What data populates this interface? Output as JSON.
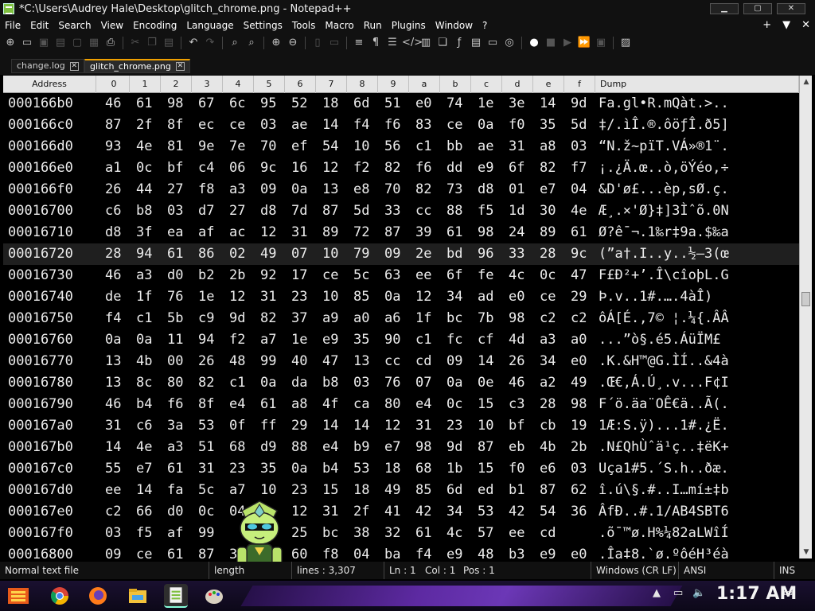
{
  "window": {
    "title": "*C:\\Users\\Audrey Hale\\Desktop\\glitch_chrome.png - Notepad++",
    "minimize_glyph": "▁",
    "restore_glyph": "▢",
    "close_glyph": "✕"
  },
  "menu": {
    "items": [
      "File",
      "Edit",
      "Search",
      "View",
      "Encoding",
      "Language",
      "Settings",
      "Tools",
      "Macro",
      "Run",
      "Plugins",
      "Window",
      "?"
    ],
    "right": [
      "+",
      "▼",
      "✕"
    ]
  },
  "tabs": [
    {
      "label": "change.log",
      "close": "✕"
    },
    {
      "label": "glitch_chrome.png",
      "close": "✕"
    }
  ],
  "hex": {
    "address_header": "Address",
    "column_headers": [
      "0",
      "1",
      "2",
      "3",
      "4",
      "5",
      "6",
      "7",
      "8",
      "9",
      "a",
      "b",
      "c",
      "d",
      "e",
      "f"
    ],
    "dump_header": "Dump",
    "rows": [
      {
        "addr": "000166b0",
        "bytes": [
          "46",
          "61",
          "98",
          "67",
          "6c",
          "95",
          "52",
          "18",
          "6d",
          "51",
          "e0",
          "74",
          "1e",
          "3e",
          "14",
          "9d"
        ],
        "dump": "Fa.gl•R.mQàt.>.."
      },
      {
        "addr": "000166c0",
        "bytes": [
          "87",
          "2f",
          "8f",
          "ec",
          "ce",
          "03",
          "ae",
          "14",
          "f4",
          "f6",
          "83",
          "ce",
          "0a",
          "f0",
          "35",
          "5d"
        ],
        "dump": "‡/.ìÎ.®.ôöƒÎ.ð5]"
      },
      {
        "addr": "000166d0",
        "bytes": [
          "93",
          "4e",
          "81",
          "9e",
          "7e",
          "70",
          "ef",
          "54",
          "10",
          "56",
          "c1",
          "bb",
          "ae",
          "31",
          "a8",
          "03"
        ],
        "dump": "“N.ž~pïT.VÁ»®1¨."
      },
      {
        "addr": "000166e0",
        "bytes": [
          "a1",
          "0c",
          "bf",
          "c4",
          "06",
          "9c",
          "16",
          "12",
          "f2",
          "82",
          "f6",
          "dd",
          "e9",
          "6f",
          "82",
          "f7"
        ],
        "dump": "¡.¿Ä.œ..ò‚öÝéo‚÷"
      },
      {
        "addr": "000166f0",
        "bytes": [
          "26",
          "44",
          "27",
          "f8",
          "a3",
          "09",
          "0a",
          "13",
          "e8",
          "70",
          "82",
          "73",
          "d8",
          "01",
          "e7",
          "04"
        ],
        "dump": "&D'ø£...èp‚sØ.ç."
      },
      {
        "addr": "00016700",
        "bytes": [
          "c6",
          "b8",
          "03",
          "d7",
          "27",
          "d8",
          "7d",
          "87",
          "5d",
          "33",
          "cc",
          "88",
          "f5",
          "1d",
          "30",
          "4e"
        ],
        "dump": "Æ¸.×'Ø}‡]3Ìˆõ.0N"
      },
      {
        "addr": "00016710",
        "bytes": [
          "d8",
          "3f",
          "ea",
          "af",
          "ac",
          "12",
          "31",
          "89",
          "72",
          "87",
          "39",
          "61",
          "98",
          "24",
          "89",
          "61"
        ],
        "dump": "Ø?ê¯¬.1‰r‡9a.$‰a"
      },
      {
        "addr": "00016720",
        "bytes": [
          "28",
          "94",
          "61",
          "86",
          "02",
          "49",
          "07",
          "10",
          "79",
          "09",
          "2e",
          "bd",
          "96",
          "33",
          "28",
          "9c"
        ],
        "dump": "(”a†.I..y..½–3(œ"
      },
      {
        "addr": "00016730",
        "bytes": [
          "46",
          "a3",
          "d0",
          "b2",
          "2b",
          "92",
          "17",
          "ce",
          "5c",
          "63",
          "ee",
          "6f",
          "fe",
          "4c",
          "0c",
          "47"
        ],
        "dump": "F£Ð²+’.Î\\cîoþL.G"
      },
      {
        "addr": "00016740",
        "bytes": [
          "de",
          "1f",
          "76",
          "1e",
          "12",
          "31",
          "23",
          "10",
          "85",
          "0a",
          "12",
          "34",
          "ad",
          "e0",
          "ce",
          "29"
        ],
        "dump": "Þ.v..1#.….4­àÎ)"
      },
      {
        "addr": "00016750",
        "bytes": [
          "f4",
          "c1",
          "5b",
          "c9",
          "9d",
          "82",
          "37",
          "a9",
          "a0",
          "a6",
          "1f",
          "bc",
          "7b",
          "98",
          "c2",
          "c2"
        ],
        "dump": "ôÁ[É.‚7© ¦.¼{.ÂÂ"
      },
      {
        "addr": "00016760",
        "bytes": [
          "0a",
          "0a",
          "11",
          "94",
          "f2",
          "a7",
          "1e",
          "e9",
          "35",
          "90",
          "c1",
          "fc",
          "cf",
          "4d",
          "a3",
          "a0"
        ],
        "dump": "...”ò§.é5.ÁüÏM£ "
      },
      {
        "addr": "00016770",
        "bytes": [
          "13",
          "4b",
          "00",
          "26",
          "48",
          "99",
          "40",
          "47",
          "13",
          "cc",
          "cd",
          "09",
          "14",
          "26",
          "34",
          "e0"
        ],
        "dump": ".K.&H™@G.ÌÍ..&4à"
      },
      {
        "addr": "00016780",
        "bytes": [
          "13",
          "8c",
          "80",
          "82",
          "c1",
          "0a",
          "da",
          "b8",
          "03",
          "76",
          "07",
          "0a",
          "0e",
          "46",
          "a2",
          "49"
        ],
        "dump": ".Œ€‚Á.Ú¸.v...F¢I"
      },
      {
        "addr": "00016790",
        "bytes": [
          "46",
          "b4",
          "f6",
          "8f",
          "e4",
          "61",
          "a8",
          "4f",
          "ca",
          "80",
          "e4",
          "0c",
          "15",
          "c3",
          "28",
          "98"
        ],
        "dump": "F´ö.äa¨OÊ€ä..Ã(."
      },
      {
        "addr": "000167a0",
        "bytes": [
          "31",
          "c6",
          "3a",
          "53",
          "0f",
          "ff",
          "29",
          "14",
          "14",
          "12",
          "31",
          "23",
          "10",
          "bf",
          "cb",
          "19"
        ],
        "dump": "1Æ:S.ÿ)...1#.¿Ë."
      },
      {
        "addr": "000167b0",
        "bytes": [
          "14",
          "4e",
          "a3",
          "51",
          "68",
          "d9",
          "88",
          "e4",
          "b9",
          "e7",
          "98",
          "9d",
          "87",
          "eb",
          "4b",
          "2b"
        ],
        "dump": ".N£QhÙˆä¹ç..‡ëK+"
      },
      {
        "addr": "000167c0",
        "bytes": [
          "55",
          "e7",
          "61",
          "31",
          "23",
          "35",
          "0a",
          "b4",
          "53",
          "18",
          "68",
          "1b",
          "15",
          "f0",
          "e6",
          "03"
        ],
        "dump": "Uça1#5.´S.h..ðæ."
      },
      {
        "addr": "000167d0",
        "bytes": [
          "ee",
          "14",
          "fa",
          "5c",
          "a7",
          "10",
          "23",
          "15",
          "18",
          "49",
          "85",
          "6d",
          "ed",
          "b1",
          "87",
          "62"
        ],
        "dump": "î.ú\\§.#..I…mí±‡b"
      },
      {
        "addr": "000167e0",
        "bytes": [
          "c2",
          "66",
          "d0",
          "0c",
          "04",
          "",
          "12",
          "31",
          "2f",
          "41",
          "42",
          "34",
          "53",
          "42",
          "54",
          "36"
        ],
        "dump": "ÂfÐ..#.1/AB4SBT6"
      },
      {
        "addr": "000167f0",
        "bytes": [
          "03",
          "f5",
          "af",
          "99",
          "",
          "48",
          "25",
          "bc",
          "38",
          "32",
          "61",
          "4c",
          "57",
          "ee",
          "cd",
          ""
        ],
        "dump": ".õ¯™ø.H%¼82aLWîÍ"
      },
      {
        "addr": "00016800",
        "bytes": [
          "09",
          "ce",
          "61",
          "87",
          "38",
          "",
          "60",
          "f8",
          "04",
          "ba",
          "f4",
          "e9",
          "48",
          "b3",
          "e9",
          "e0"
        ],
        "dump": ".Îa‡8.`ø.ºôéH³éà"
      }
    ],
    "current_row_index": 7
  },
  "status": {
    "file_type": "Normal text file",
    "length": "length",
    "lines": "lines : 3,307",
    "ln": "Ln : 1",
    "col": "Col : 1",
    "pos": "Pos : 1",
    "eol": "Windows (CR LF)",
    "encoding": "ANSI",
    "mode": "INS"
  },
  "taskbar": {
    "clock": "1:17 AM"
  }
}
